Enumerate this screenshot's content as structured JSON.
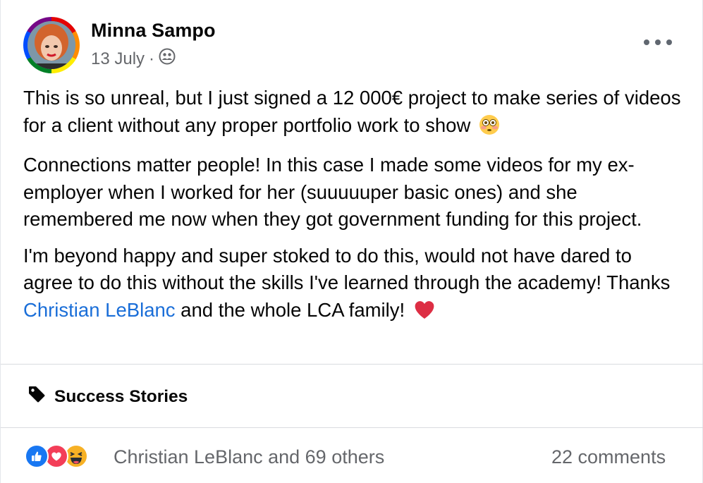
{
  "post": {
    "author": "Minna Sampo",
    "date": "13 July",
    "separator": "·",
    "audience_icon": "friends-icon",
    "more_icon": "more-horizontal-icon",
    "body": {
      "p1": "This is so unreal, but I just signed a 12 000€ project to make series of videos for a client without any proper portfolio work to show",
      "p1_emoji": "flushed-face-emoji",
      "p2": "Connections matter people! In this case I made some videos for my ex-employer when I worked for her (suuuuuper basic ones) and she remembered me now when they got government funding for this project.",
      "p3_before": "I'm beyond happy and super stoked to do this, would not have dared to agree to do this without the skills I've learned through the academy! Thanks ",
      "p3_link": "Christian LeBlanc",
      "p3_after": " and the whole LCA family!",
      "p3_emoji": "red-heart-emoji"
    },
    "topic": {
      "icon": "tag-icon",
      "label": "Success Stories"
    },
    "footer": {
      "reactions": [
        "like-reaction-icon",
        "love-reaction-icon",
        "haha-reaction-icon"
      ],
      "reactors": "Christian LeBlanc and 69 others",
      "comments": "22 comments"
    },
    "colors": {
      "link": "#1a6ed8",
      "meta": "#65676b",
      "like": "#1877f2",
      "love": "#f33e58",
      "haha": "#f7b125"
    }
  }
}
